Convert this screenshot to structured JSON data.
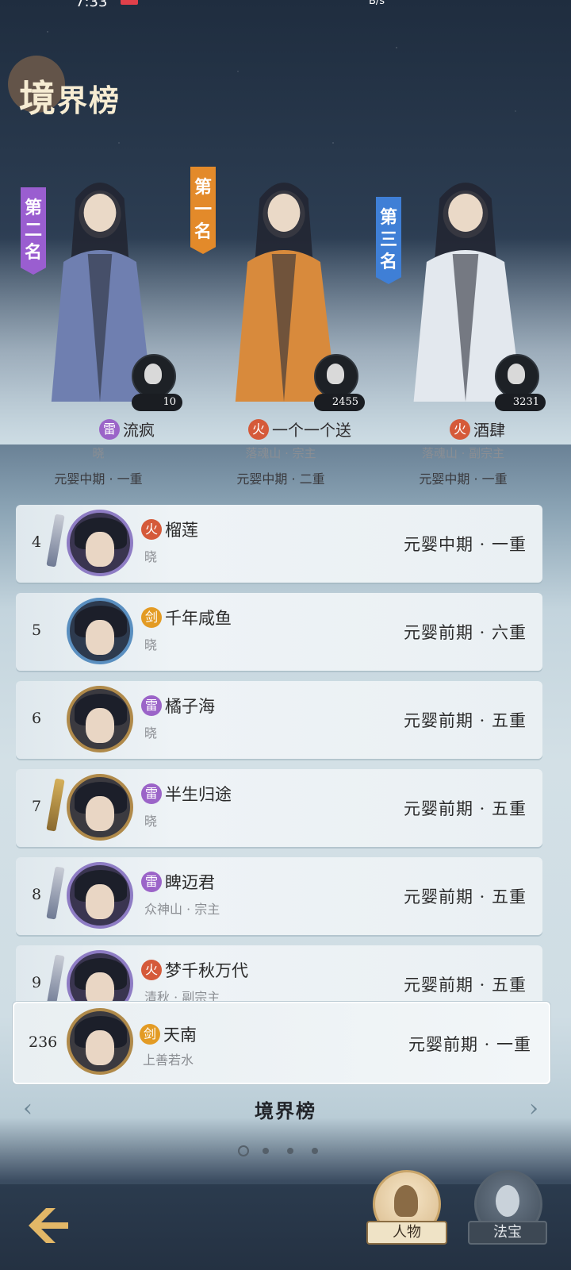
{
  "status_bar": {
    "time": "7:33",
    "net_speed": "B/s"
  },
  "screen_title": {
    "main": "境",
    "rest": "界榜"
  },
  "podium": [
    {
      "rank_label": "第二名",
      "banner_color": "#9a5ed0",
      "element": "雷",
      "element_color": "#9b64c8",
      "name": "流疯",
      "sub": "晓",
      "realm": "元婴中期 · 一重",
      "count": "10",
      "figure_color": "#6f7fb0"
    },
    {
      "rank_label": "第一名",
      "banner_color": "#e38a2a",
      "element": "火",
      "element_color": "#d55a3a",
      "name": "一个一个送",
      "sub": "落魂山 · 宗主",
      "realm": "元婴中期 · 二重",
      "count": "2455",
      "figure_color": "#d88a3c"
    },
    {
      "rank_label": "第三名",
      "banner_color": "#3f7fd6",
      "element": "火",
      "element_color": "#d55a3a",
      "name": "酒肆",
      "sub": "落魂山 · 副宗主",
      "realm": "元婴中期 · 一重",
      "count": "3231",
      "figure_color": "#e3e8ee"
    }
  ],
  "ranking": [
    {
      "rank": "4",
      "element": "火",
      "name": "榴莲",
      "sub": "晓",
      "realm": "元婴中期 · 一重",
      "frame": "purple",
      "deco": "sword"
    },
    {
      "rank": "5",
      "element": "剑",
      "name": "千年咸鱼",
      "sub": "晓",
      "realm": "元婴前期 · 六重",
      "frame": "blue",
      "deco": "none"
    },
    {
      "rank": "6",
      "element": "雷",
      "name": "橘子海",
      "sub": "晓",
      "realm": "元婴前期 · 五重",
      "frame": "gold",
      "deco": "none"
    },
    {
      "rank": "7",
      "element": "雷",
      "name": "半生归途",
      "sub": "晓",
      "realm": "元婴前期 · 五重",
      "frame": "gold",
      "deco": "gold"
    },
    {
      "rank": "8",
      "element": "雷",
      "name": "睥迈君",
      "sub": "众神山 · 宗主",
      "realm": "元婴前期 · 五重",
      "frame": "purple",
      "deco": "sword"
    },
    {
      "rank": "9",
      "element": "火",
      "name": "梦千秋万代",
      "sub": "清秋 · 副宗主",
      "realm": "元婴前期 · 五重",
      "frame": "purple",
      "deco": "sword"
    }
  ],
  "self_entry": {
    "rank": "236",
    "element": "剑",
    "name": "天南",
    "sub": "上善若水",
    "realm": "元婴前期 · 一重"
  },
  "pager": {
    "title": "境界榜",
    "pages": 4,
    "active": 0
  },
  "bottom_nav": {
    "character_label": "人物",
    "treasure_label": "法宝"
  },
  "colors": {
    "fire": "#d55a3a",
    "thunder": "#9b64c8",
    "sword": "#e39b24",
    "accent_gold": "#e2b767"
  }
}
